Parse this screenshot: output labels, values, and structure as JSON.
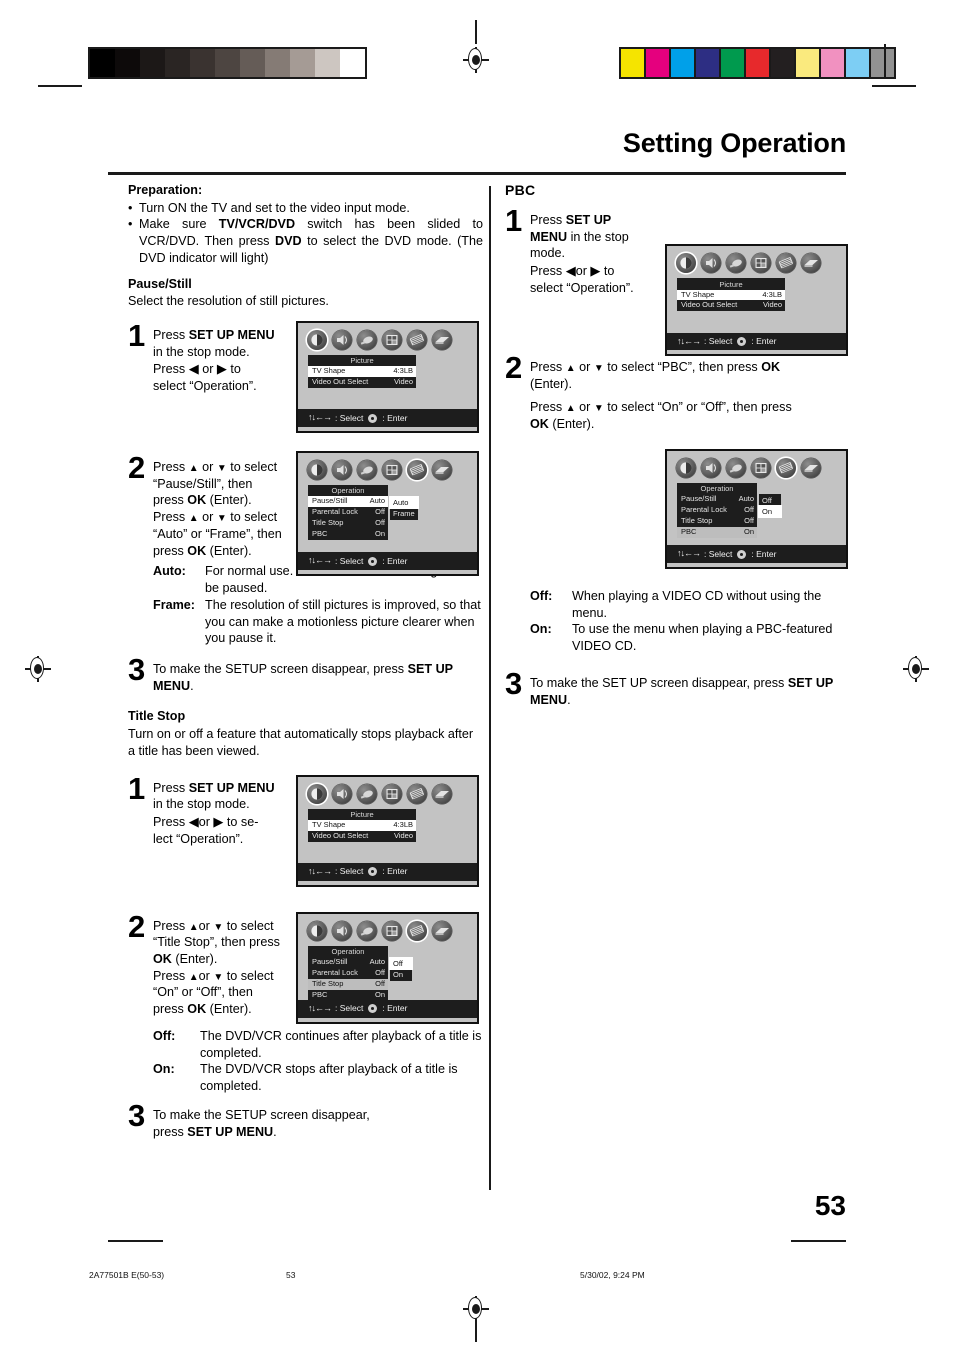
{
  "header": {
    "title": "Setting Operation"
  },
  "page_number": "53",
  "footer": {
    "doc_code": "2A77501B E(50-53)",
    "page": "53",
    "timestamp": "5/30/02, 9:24 PM"
  },
  "colorbars": {
    "gray": [
      "#000000",
      "#0d0a0a",
      "#1c1817",
      "#2a2523",
      "#3a3330",
      "#4d4541",
      "#655c57",
      "#857b75",
      "#a59b95",
      "#cdc6c1",
      "#ffffff"
    ],
    "color": [
      "#f5e400",
      "#e5007e",
      "#00a0e9",
      "#2d2e83",
      "#009a4e",
      "#e7292c",
      "#231f20",
      "#faea7e",
      "#f191c0",
      "#7dcef4",
      "#929292"
    ]
  },
  "left_column": {
    "preparation": {
      "heading": "Preparation:",
      "bullets": [
        "Turn ON the TV and set to the video input mode.",
        "Make sure TV/VCR/DVD switch has been slided to VCR/DVD. Then press DVD to select the DVD mode. (The DVD indicator will light)"
      ]
    },
    "pause_still": {
      "heading": "Pause/Still",
      "intro": "Select the resolution of still pictures.",
      "step1": {
        "number": "1",
        "line1_a": "Press ",
        "line1_b": "SET UP MENU",
        "line2": "in the stop mode.",
        "line3_a": "Press ",
        "line3_b": " or ",
        "line4": "select “Operation”."
      },
      "step2": {
        "number": "2",
        "text": "Press ▲ or ▼ to select “Pause/Still”, then press OK (Enter). Press ▲ or ▼ to select “Auto” or “Frame”, then press OK (Enter).",
        "defs": [
          {
            "term": "Auto:",
            "desc": "For normal use. Still and fast motion images can be paused."
          },
          {
            "term": "Frame:",
            "desc": "The resolution of still pictures is improved, so that you can make a motionless picture clearer when you pause it."
          }
        ]
      },
      "step3": {
        "number": "3",
        "text_a": "To make the SETUP screen disappear, press ",
        "text_b": "SET UP MENU",
        "text_c": "."
      }
    },
    "title_stop": {
      "heading": "Title Stop",
      "intro": "Turn on or off a feature that automatically stops playback after a title has been viewed.",
      "step1": {
        "number": "1",
        "line1_a": "Press ",
        "line1_b": "SET UP MENU",
        "line2": "in the stop mode.",
        "line3_a": "Press ",
        "line3_b": " or ",
        "line3_c": " to se-",
        "line4": "lect “Operation”."
      },
      "step2": {
        "number": "2",
        "text": "Press ▲ or ▼ to select “Title Stop”, then press OK (Enter). Press ▲ or ▼ to select “On” or “Off”, then press OK (Enter).",
        "defs": [
          {
            "term": "Off:",
            "desc": "The DVD/VCR continues after playback of a title is completed."
          },
          {
            "term": "On:",
            "desc": "The DVD/VCR stops after playback of a title is completed."
          }
        ]
      },
      "step3": {
        "number": "3",
        "text_a": "To make the SETUP screen disappear,",
        "text_b": "press ",
        "text_c": "SET UP MENU",
        "text_d": "."
      }
    }
  },
  "right_column": {
    "pbc": {
      "heading": "PBC",
      "step1": {
        "number": "1",
        "line1_a": "Press ",
        "line1_b": "SET UP",
        "line2_b": "MENU",
        "line2_a": " in the stop",
        "line3": "mode.",
        "line4_a": "Press ",
        "line4_b": " or ",
        "line4_c": " to",
        "line5": "select “Operation”."
      },
      "step2": {
        "number": "2",
        "para1": "Press ▲ or ▼ to select “PBC”, then press OK (Enter).",
        "para2": "Press ▲ or ▼ to select “On” or “Off”, then press OK (Enter)."
      },
      "defs": [
        {
          "term": "Off:",
          "desc": "When playing a VIDEO CD without using the menu."
        },
        {
          "term": "On:",
          "desc": "To use the menu when playing a PBC-featured VIDEO CD."
        }
      ],
      "step3": {
        "number": "3",
        "text_a": "To make the SET UP screen disappear, press ",
        "text_b": "SET UP MENU",
        "text_c": "."
      }
    }
  },
  "osd": {
    "icon_names": [
      "picture-icon",
      "audio-icon",
      "language-icon",
      "display-icon",
      "operation-icon",
      "disc-icon"
    ],
    "footer_select": ": Select",
    "footer_enter": ": Enter",
    "footer_arrows": "↑↓←→",
    "picture_screen": {
      "panel_title": "Picture",
      "rows": [
        {
          "label": "TV Shape",
          "value": "4:3LB",
          "highlight": "white"
        },
        {
          "label": "Video Out Select",
          "value": "Video",
          "highlight": "none"
        }
      ],
      "selected_icon": 0
    },
    "operation_pause_screen": {
      "panel_title": "Operation",
      "rows": [
        {
          "label": "Pause/Still",
          "value": "Auto",
          "highlight": "white"
        },
        {
          "label": "Parental Lock",
          "value": "Off",
          "highlight": "none"
        },
        {
          "label": "Title Stop",
          "value": "Off",
          "highlight": "none"
        },
        {
          "label": "PBC",
          "value": "On",
          "highlight": "none"
        }
      ],
      "submenu": {
        "items": [
          "Auto",
          "Frame"
        ],
        "selected": 0
      },
      "selected_icon": 4
    },
    "operation_titlestop_screen": {
      "panel_title": "Operation",
      "rows": [
        {
          "label": "Pause/Still",
          "value": "Auto",
          "highlight": "none"
        },
        {
          "label": "Parental Lock",
          "value": "Off",
          "highlight": "none"
        },
        {
          "label": "Title Stop",
          "value": "Off",
          "highlight": "white"
        },
        {
          "label": "PBC",
          "value": "On",
          "highlight": "none"
        }
      ],
      "submenu": {
        "items": [
          "Off",
          "On"
        ],
        "selected": 0
      },
      "selected_icon": 4
    },
    "operation_pbc_screen": {
      "panel_title": "Operation",
      "rows": [
        {
          "label": "Pause/Still",
          "value": "Auto",
          "highlight": "none"
        },
        {
          "label": "Parental Lock",
          "value": "Off",
          "highlight": "none"
        },
        {
          "label": "Title Stop",
          "value": "Off",
          "highlight": "none"
        },
        {
          "label": "PBC",
          "value": "On",
          "highlight": "white"
        }
      ],
      "submenu": {
        "items": [
          "Off",
          "On"
        ],
        "selected": 1
      },
      "selected_icon": 4
    }
  }
}
